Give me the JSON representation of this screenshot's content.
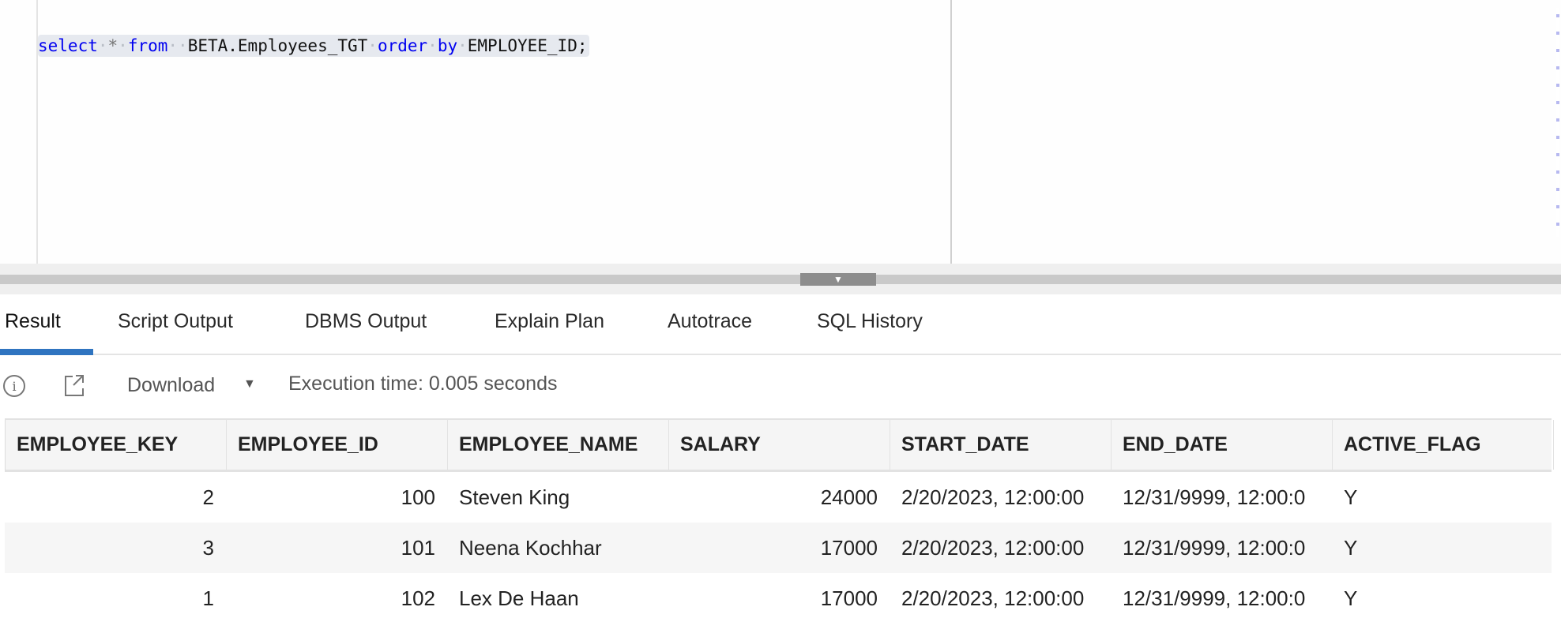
{
  "editor": {
    "tokens": {
      "select": "select",
      "star": "*",
      "from": "from",
      "table": "BETA.Employees_TGT",
      "order": "order",
      "by": "by",
      "column": "EMPLOYEE_ID;"
    }
  },
  "tabs": [
    {
      "label": "Result",
      "active": true
    },
    {
      "label": "Script Output"
    },
    {
      "label": "DBMS Output"
    },
    {
      "label": "Explain Plan"
    },
    {
      "label": "Autotrace"
    },
    {
      "label": "SQL History"
    }
  ],
  "toolbar": {
    "download_label": "Download",
    "execution_time": "Execution time: 0.005 seconds"
  },
  "table": {
    "columns": [
      "EMPLOYEE_KEY",
      "EMPLOYEE_ID",
      "EMPLOYEE_NAME",
      "SALARY",
      "START_DATE",
      "END_DATE",
      "ACTIVE_FLAG"
    ],
    "rows": [
      [
        "2",
        "100",
        "Steven King",
        "24000",
        "2/20/2023, 12:00:00",
        "12/31/9999, 12:00:0",
        "Y"
      ],
      [
        "3",
        "101",
        "Neena Kochhar",
        "17000",
        "2/20/2023, 12:00:00",
        "12/31/9999, 12:00:0",
        "Y"
      ],
      [
        "1",
        "102",
        "Lex De Haan",
        "17000",
        "2/20/2023, 12:00:00",
        "12/31/9999, 12:00:0",
        "Y"
      ]
    ]
  },
  "colors": {
    "accent": "#2f74c0",
    "keyword": "#0000f0"
  }
}
